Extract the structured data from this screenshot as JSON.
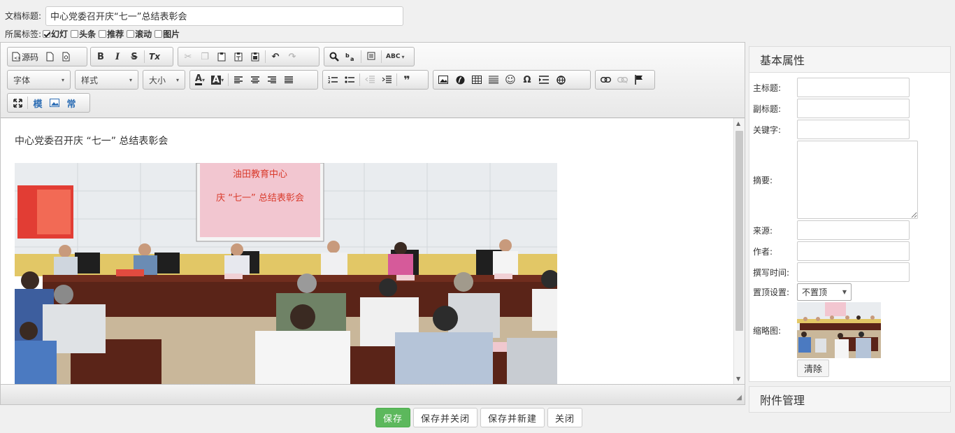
{
  "doc": {
    "title_label": "文档标题:",
    "title_value": "中心党委召开庆“七一”总结表彰会",
    "tags_label": "所属标签:",
    "tags": [
      {
        "label": "幻灯",
        "checked": true
      },
      {
        "label": "头条",
        "checked": false
      },
      {
        "label": "推荐",
        "checked": false
      },
      {
        "label": "滚动",
        "checked": false
      },
      {
        "label": "图片",
        "checked": false
      }
    ]
  },
  "toolbar": {
    "source_label": "源码",
    "font_label": "字体",
    "style_label": "样式",
    "size_label": "大小",
    "bold": "B",
    "italic": "I",
    "strike": "S",
    "clear_format": "Tx",
    "omega": "Ω",
    "quote": "99",
    "template_label": "模",
    "common_label": "常"
  },
  "content": {
    "heading": "中心党委召开庆 “七一” 总结表彰会",
    "banner_line1": "油田教育中心",
    "banner_line2": "庆 “七一” 总结表彰会"
  },
  "panel": {
    "title": "基本属性",
    "fields": {
      "main_title": "主标题:",
      "sub_title": "副标题:",
      "keywords": "关键字:",
      "summary": "摘要:",
      "source": "来源:",
      "author": "作者:",
      "write_time": "撰写时间:",
      "top_setting": "置顶设置:",
      "thumbnail": "缩略图:"
    },
    "top_value": "不置顶",
    "clear_label": "清除",
    "attachments_title": "附件管理"
  },
  "actions": {
    "save": "保存",
    "save_close": "保存并关闭",
    "save_new": "保存并新建",
    "close": "关闭"
  },
  "colors": {
    "save_button": "#5cb85c",
    "banner_bg": "#f2c6d0",
    "banner_text": "#d93a2b",
    "link_icon": "#2f6fb5"
  }
}
